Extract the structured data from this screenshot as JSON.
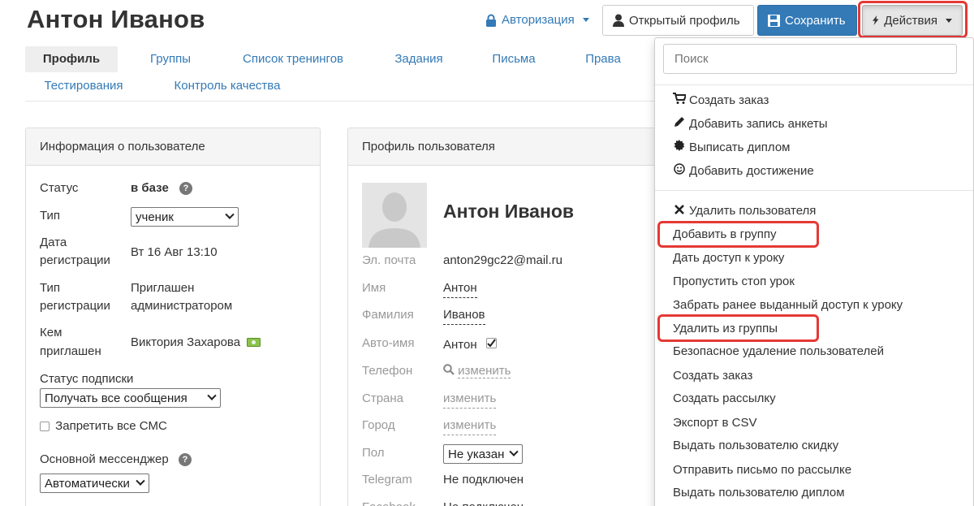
{
  "header": {
    "title": "Антон Иванов",
    "auth_label": "Авторизация",
    "open_profile_label": "Открытый профиль",
    "save_label": "Сохранить",
    "actions_label": "Действия"
  },
  "tabs": [
    {
      "label": "Профиль",
      "active": true
    },
    {
      "label": "Группы"
    },
    {
      "label": "Список тренингов"
    },
    {
      "label": "Задания"
    },
    {
      "label": "Письма"
    },
    {
      "label": "Права"
    },
    {
      "label": "Тестирования"
    },
    {
      "label": "Контроль качества"
    }
  ],
  "user_info": {
    "heading": "Информация о пользователе",
    "status_label": "Статус",
    "status_value": "в базе",
    "type_label": "Тип",
    "type_value": "ученик",
    "reg_date_label_1": "Дата",
    "reg_date_label_2": "регистрации",
    "reg_date_value": "Вт 16 Авг 13:10",
    "reg_type_label_1": "Тип",
    "reg_type_label_2": "регистрации",
    "reg_type_value_1": "Приглашен",
    "reg_type_value_2": "администратором",
    "invited_by_label_1": "Кем",
    "invited_by_label_2": "приглашен",
    "invited_by_value": "Виктория Захарова",
    "subscription_label": "Статус подписки",
    "subscription_value": "Получать все сообщения",
    "block_sms_label": "Запретить все СМС",
    "messenger_label": "Основной мессенджер",
    "messenger_value": "Автоматически"
  },
  "profile": {
    "heading": "Профиль пользователя",
    "name": "Антон Иванов",
    "email_label": "Эл. почта",
    "email_value": "anton29gc22@mail.ru",
    "first_name_label": "Имя",
    "first_name_value": "Антон",
    "last_name_label": "Фамилия",
    "last_name_value": "Иванов",
    "auto_name_label": "Авто-имя",
    "auto_name_value": "Антон",
    "phone_label": "Телефон",
    "phone_value": "изменить",
    "country_label": "Страна",
    "country_value": "изменить",
    "city_label": "Город",
    "city_value": "изменить",
    "gender_label": "Пол",
    "gender_value": "Не указан",
    "telegram_label": "Telegram",
    "telegram_value": "Не подключен",
    "facebook_label": "Facebook",
    "facebook_value": "Не подключен"
  },
  "actions_menu": {
    "search_placeholder": "Поиск",
    "group1": [
      {
        "label": "Создать заказ",
        "icon": "cart-icon"
      },
      {
        "label": "Добавить запись анкеты",
        "icon": "pencil-icon"
      },
      {
        "label": "Выписать диплом",
        "icon": "certificate-icon"
      },
      {
        "label": "Добавить достижение",
        "icon": "smile-icon"
      }
    ],
    "group2": [
      {
        "label": "Удалить пользователя",
        "icon": "remove-icon"
      },
      {
        "label": "Добавить в группу"
      },
      {
        "label": "Дать доступ к уроку"
      },
      {
        "label": "Пропустить стоп урок"
      },
      {
        "label": "Забрать ранее выданный доступ к уроку"
      },
      {
        "label": "Удалить из группы"
      },
      {
        "label": "Безопасное удаление пользователей"
      },
      {
        "label": "Создать заказ"
      },
      {
        "label": "Создать рассылку"
      },
      {
        "label": "Экспорт в CSV"
      },
      {
        "label": "Выдать пользователю скидку"
      },
      {
        "label": "Отправить письмо по рассылке"
      },
      {
        "label": "Выдать пользователю диплом"
      }
    ]
  },
  "colors": {
    "link": "#337ab7",
    "primary": "#337ab7",
    "highlight": "#e53935"
  }
}
